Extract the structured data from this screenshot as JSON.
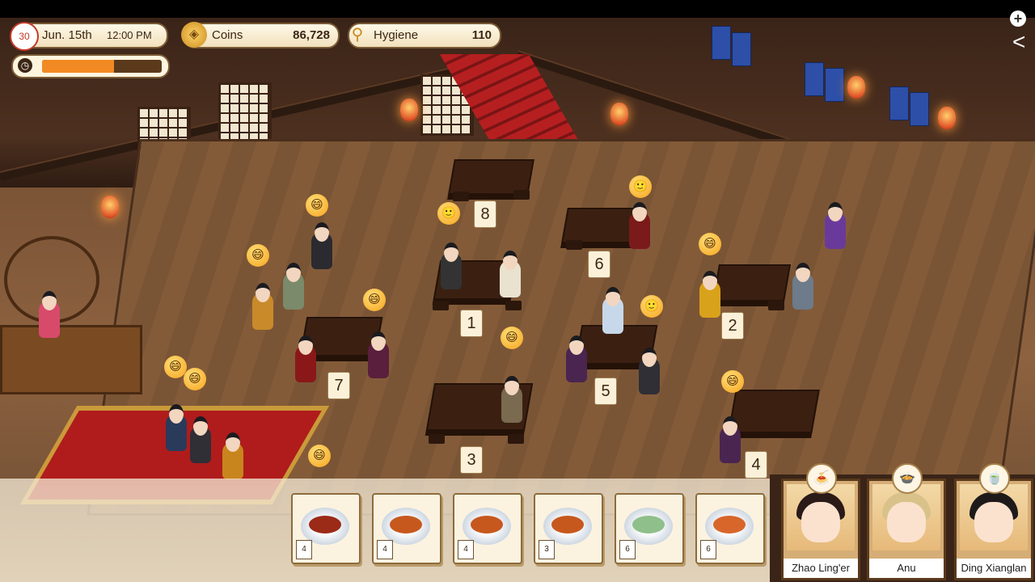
{
  "hud": {
    "date_badge": "30",
    "date": "Jun. 15th",
    "time": "12:00 PM",
    "coins_label": "Coins",
    "coins_value": "86,728",
    "hygiene_label": "Hygiene",
    "hygiene_value": "110",
    "timer_progress": 0.6,
    "add_button": "+",
    "back_button": "<"
  },
  "tables": [
    "1",
    "2",
    "3",
    "4",
    "5",
    "6",
    "7",
    "8"
  ],
  "reactions": {
    "happy": "😄",
    "waiting": "🙂"
  },
  "dishes": [
    {
      "qty": "4",
      "icon": "braised-pork-icon",
      "color": "#9b2a17"
    },
    {
      "qty": "4",
      "icon": "braised-fish-icon",
      "color": "#c7581d"
    },
    {
      "qty": "4",
      "icon": "braised-fish-icon",
      "color": "#c7581d"
    },
    {
      "qty": "3",
      "icon": "braised-fish-icon",
      "color": "#c7581d"
    },
    {
      "qty": "6",
      "icon": "wine-jar-icon",
      "color": "#8fbf8a"
    },
    {
      "qty": "6",
      "icon": "noodle-bowl-icon",
      "color": "#d8662a"
    }
  ],
  "chefs": [
    {
      "name": "Zhao Ling'er",
      "dish_icon": "🍝"
    },
    {
      "name": "Anu",
      "dish_icon": "🍲"
    },
    {
      "name": "Ding Xianglan",
      "dish_icon": "🍵"
    }
  ]
}
